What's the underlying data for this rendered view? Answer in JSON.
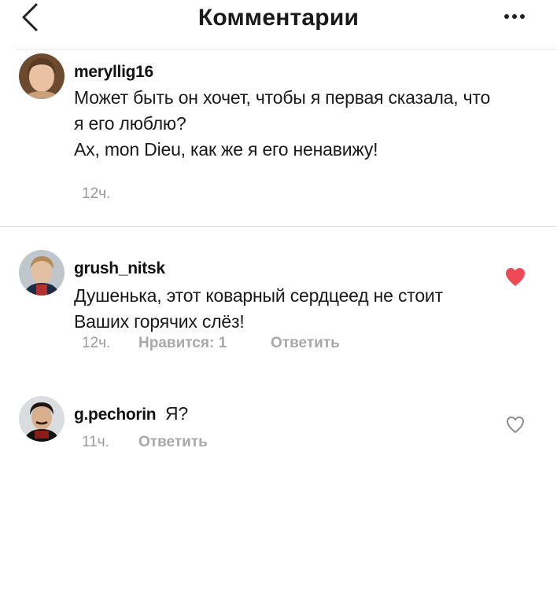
{
  "header": {
    "title": "Комментарии",
    "back_icon": "chevron-left-icon",
    "more_icon": "more-horizontal-icon"
  },
  "comments": [
    {
      "username": "meryllig16",
      "lines": [
        "Может быть он хочет, чтобы я первая сказала, что",
        "я его люблю?",
        "Ах, mon Dieu, как же я его ненавижу!"
      ],
      "time": "12ч.",
      "liked": false
    },
    {
      "username": "grush_nitsk",
      "lines": [
        "Душенька, этот коварный сердцеед не стоит",
        "Ваших горячих слёз!"
      ],
      "time": "12ч.",
      "likes_label": "Нравится: 1",
      "reply_label": "Ответить",
      "liked": true,
      "like_color": "#ed4956"
    },
    {
      "username": "g.pechorin",
      "text": "Я?",
      "time": "11ч.",
      "reply_label": "Ответить",
      "liked": false
    }
  ]
}
